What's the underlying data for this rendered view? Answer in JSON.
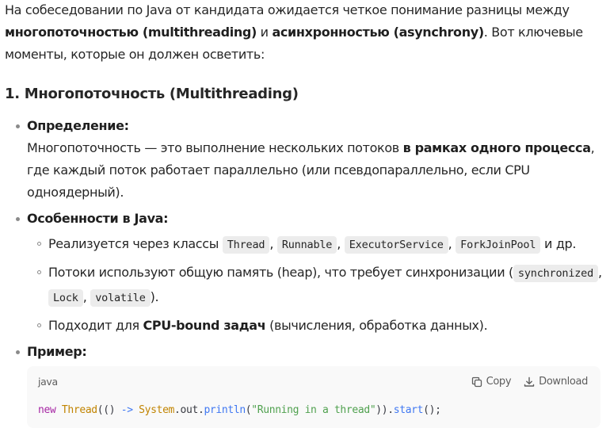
{
  "intro": {
    "t1": "На собеседовании по Java от кандидата ожидается четкое понимание разницы между ",
    "b1": "многопоточностью (multithreading)",
    "t2": " и ",
    "b2": "асинхронностью (asynchrony)",
    "t3": ". Вот ключевые моменты, которые он должен осветить:"
  },
  "section1": {
    "heading": "1. Многопоточность (Multithreading)",
    "definition": {
      "title": "Определение:",
      "t1": "Многопоточность — это выполнение нескольких потоков ",
      "b1": "в рамках одного процесса",
      "t2": ", где каждый поток работает параллельно (или псевдопараллельно, если CPU одноядерный)."
    },
    "features": {
      "title": "Особенности в Java:",
      "item1": {
        "t1": "Реализуется через классы ",
        "codes": [
          "Thread",
          "Runnable",
          "ExecutorService",
          "ForkJoinPool"
        ],
        "sep": ",",
        "t2": " и др."
      },
      "item2": {
        "t1": "Потоки используют общую память (heap), что требует синхронизации (",
        "codes": [
          "synchronized",
          "Lock",
          "volatile"
        ],
        "sep": ",",
        "t2": ")."
      },
      "item3": {
        "t1": "Подходит для ",
        "b1": "CPU-bound задач",
        "t2": " (вычисления, обработка данных)."
      }
    },
    "example": {
      "title": "Пример:",
      "code_block": {
        "language": "java",
        "copy_label": "Copy",
        "download_label": "Download",
        "tokens": {
          "kw_new": "new",
          "cls_thread": "Thread",
          "p1": "(() ",
          "arrow": "->",
          "sp": " ",
          "cls_system": "System",
          "dot1": ".",
          "fld_out": "out",
          "dot2": ".",
          "fn_println": "println",
          "p2": "(",
          "str": "\"Running in a thread\"",
          "p3": ")).",
          "fn_start": "start",
          "p4": "();"
        }
      }
    }
  },
  "colors": {
    "text": "#262626",
    "inline_code_bg": "#ececec",
    "code_block_bg": "#f9f9f9",
    "keyword": "#a626a4",
    "class": "#c18401",
    "function": "#4078f2",
    "string": "#50a14f"
  },
  "icons": {
    "copy": "copy-icon",
    "download": "download-icon"
  }
}
